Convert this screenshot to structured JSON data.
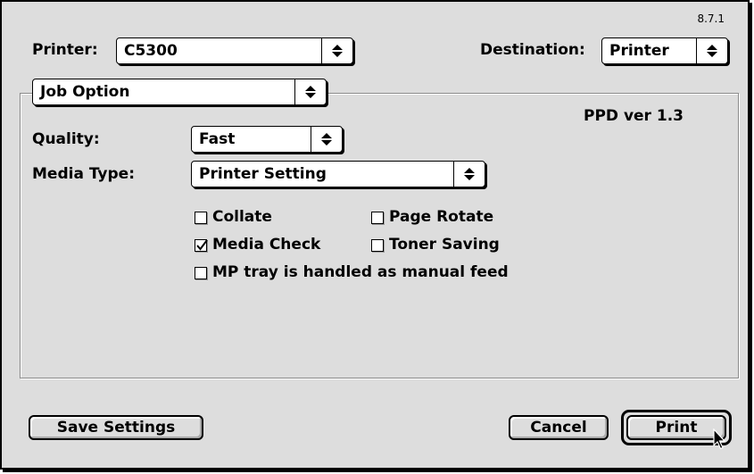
{
  "version": "8.7.1",
  "printer": {
    "label": "Printer:",
    "value": "C5300"
  },
  "destination": {
    "label": "Destination:",
    "value": "Printer"
  },
  "panel": {
    "value": "Job Option",
    "ppd_version": "PPD ver 1.3"
  },
  "quality": {
    "label": "Quality:",
    "value": "Fast"
  },
  "media_type": {
    "label": "Media Type:",
    "value": "Printer Setting"
  },
  "checkboxes": {
    "collate": {
      "label": "Collate",
      "checked": false
    },
    "page_rotate": {
      "label": "Page Rotate",
      "checked": false
    },
    "media_check": {
      "label": "Media Check",
      "checked": true
    },
    "toner_saving": {
      "label": "Toner Saving",
      "checked": false
    },
    "mp_tray": {
      "label": "MP tray is handled as manual feed",
      "checked": false
    }
  },
  "buttons": {
    "save_settings": "Save Settings",
    "cancel": "Cancel",
    "print": "Print"
  }
}
